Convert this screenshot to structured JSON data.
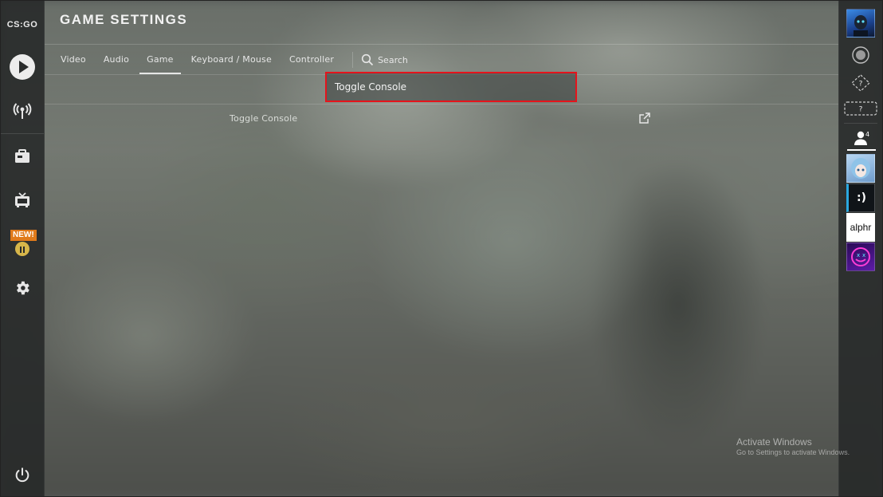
{
  "app": {
    "logo_text": "CS:GO"
  },
  "header": {
    "title": "GAME SETTINGS"
  },
  "tabs": [
    {
      "label": "Video"
    },
    {
      "label": "Audio"
    },
    {
      "label": "Game",
      "active": true
    },
    {
      "label": "Keyboard / Mouse"
    },
    {
      "label": "Controller"
    }
  ],
  "search": {
    "label": "Search",
    "query": "Toggle Console"
  },
  "results": [
    {
      "label": "Toggle Console"
    }
  ],
  "left_nav": {
    "items": [
      {
        "icon": "play-icon"
      },
      {
        "icon": "broadcast-icon"
      },
      {
        "icon": "inventory-icon"
      },
      {
        "icon": "tv-icon"
      },
      {
        "icon": "operation-icon",
        "badge": "NEW!"
      },
      {
        "icon": "gear-icon"
      },
      {
        "icon": "power-icon"
      }
    ]
  },
  "right_bar": {
    "friends_count": "4",
    "rank_placeholder": "?",
    "friends": [
      {
        "avatar_text": ""
      },
      {
        "avatar_text": ":)"
      },
      {
        "avatar_text": "alphr"
      },
      {
        "avatar_text": ""
      }
    ]
  },
  "watermark": {
    "title": "Activate Windows",
    "subtitle": "Go to Settings to activate Windows."
  },
  "colors": {
    "highlight_border": "#e5141c",
    "badge_bg": "#e07a1a",
    "text": "#e6e6e6"
  }
}
